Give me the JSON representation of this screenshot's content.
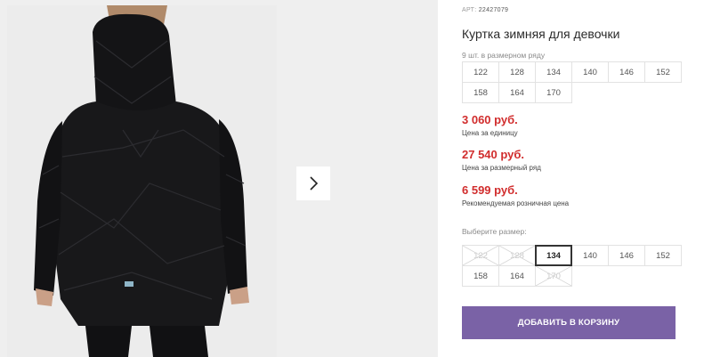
{
  "gallery": {
    "next_icon": "chevron-right-icon"
  },
  "product": {
    "sku_label": "АРТ:",
    "sku_value": "22427079",
    "title": "Куртка зимняя для девочки",
    "size_row_count": "9 шт. в размерном ряду",
    "size_row": [
      "122",
      "128",
      "134",
      "140",
      "146",
      "152",
      "158",
      "164",
      "170"
    ]
  },
  "prices": [
    {
      "value": "3 060 руб.",
      "label": "Цена за единицу"
    },
    {
      "value": "27 540 руб.",
      "label": "Цена за размерный ряд"
    },
    {
      "value": "6 599 руб.",
      "label": "Рекомендуемая розничная цена"
    }
  ],
  "size_select": {
    "label": "Выберите размер:",
    "options": [
      {
        "size": "122",
        "available": false,
        "selected": false
      },
      {
        "size": "128",
        "available": false,
        "selected": false
      },
      {
        "size": "134",
        "available": true,
        "selected": true
      },
      {
        "size": "140",
        "available": true,
        "selected": false
      },
      {
        "size": "146",
        "available": true,
        "selected": false
      },
      {
        "size": "152",
        "available": true,
        "selected": false
      },
      {
        "size": "158",
        "available": true,
        "selected": false
      },
      {
        "size": "164",
        "available": true,
        "selected": false
      },
      {
        "size": "170",
        "available": false,
        "selected": false
      }
    ]
  },
  "cart": {
    "button_label": "ДОБАВИТЬ В КОРЗИНУ"
  },
  "colors": {
    "price": "#d12d2d",
    "button": "#7a62a6"
  }
}
